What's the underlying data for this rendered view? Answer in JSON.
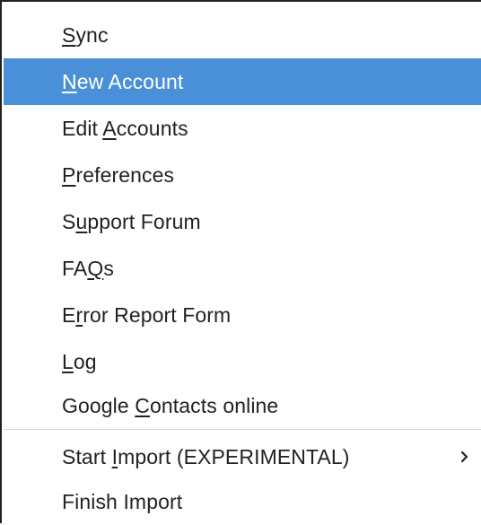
{
  "menu": {
    "items": [
      {
        "label": "Sync",
        "mnemonic_index": 0
      },
      {
        "label": "New Account",
        "mnemonic_index": 0,
        "highlighted": true
      },
      {
        "label": "Edit Accounts",
        "mnemonic_index": 5
      },
      {
        "label": "Preferences",
        "mnemonic_index": 0
      },
      {
        "label": "Support Forum",
        "mnemonic_index": 1
      },
      {
        "label": "FAQs",
        "mnemonic_index": 2
      },
      {
        "label": "Error Report Form",
        "mnemonic_index": 1
      },
      {
        "label": "Log",
        "mnemonic_index": 0
      },
      {
        "label": "Google Contacts online",
        "mnemonic_index": 7
      },
      {
        "label": "Start Import (EXPERIMENTAL)",
        "mnemonic_index": 6,
        "submenu": true,
        "submenu_icon": "chevron-right-icon"
      },
      {
        "label": "Finish Import",
        "mnemonic_index": -1
      }
    ],
    "colors": {
      "highlight": "#4a90d9",
      "highlight_text": "#ffffff",
      "text": "#222222",
      "separator": "#d6d6d6"
    }
  }
}
